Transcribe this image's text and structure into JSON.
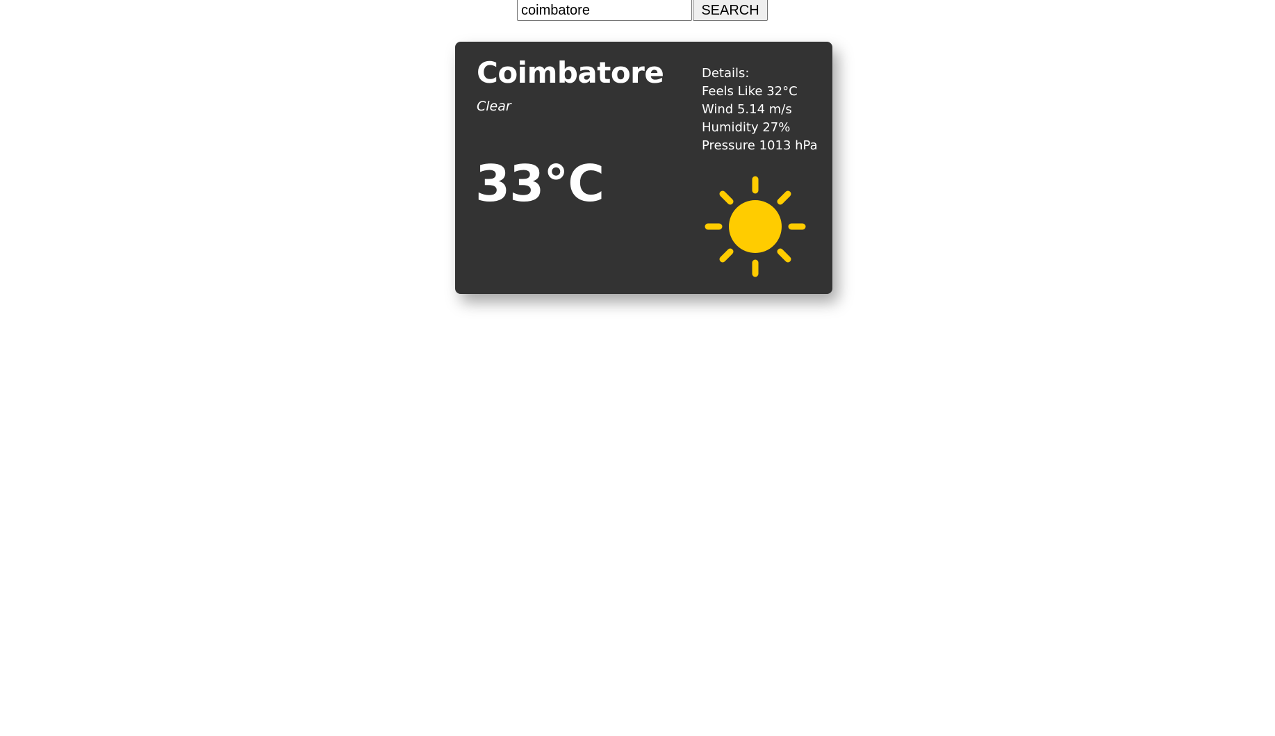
{
  "search": {
    "value": "coimbatore",
    "button_label": "SEARCH"
  },
  "weather": {
    "city": "Coimbatore",
    "condition": "Clear",
    "temperature": "33°C",
    "details_heading": "Details:",
    "feels_like": "Feels Like 32°C",
    "wind": "Wind 5.14 m/s",
    "humidity": "Humidity 27%",
    "pressure": "Pressure 1013 hPa",
    "icon": "sun-icon"
  },
  "colors": {
    "card_background": "#333333",
    "sun": "#FFCC00",
    "text": "#ffffff"
  }
}
